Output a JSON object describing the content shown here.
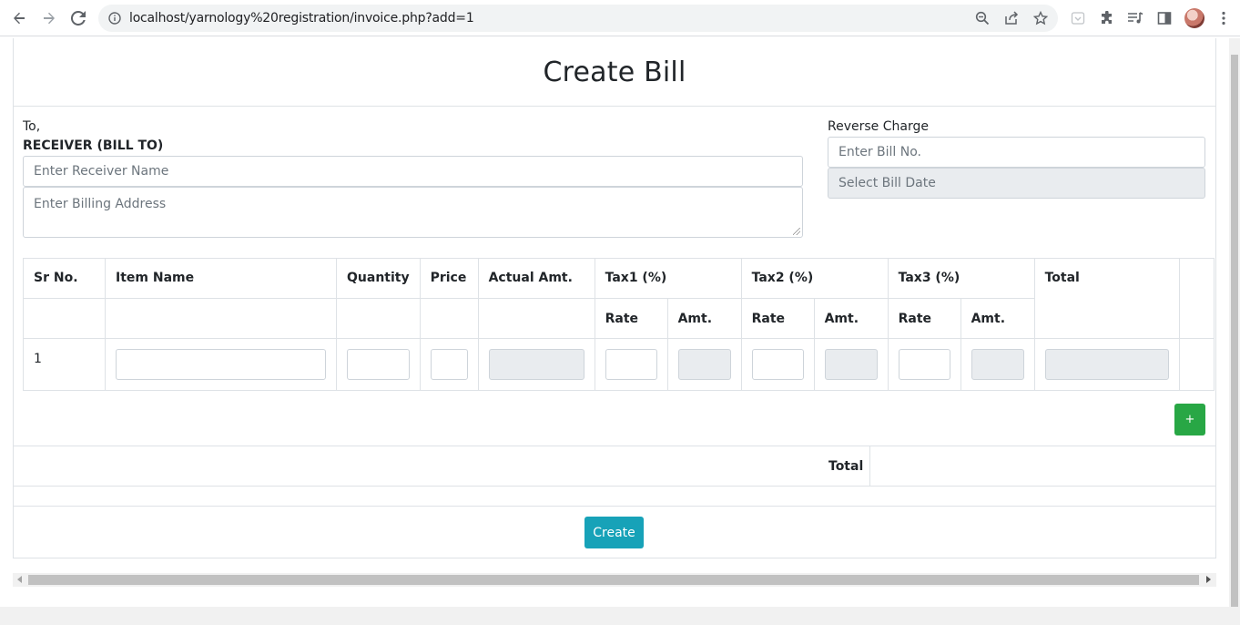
{
  "browser": {
    "url": "localhost/yarnology%20registration/invoice.php?add=1",
    "icons": [
      "back-arrow-icon",
      "forward-arrow-icon",
      "reload-icon",
      "info-icon",
      "zoom-icon",
      "share-icon",
      "star-icon",
      "pocket-icon",
      "extensions-icon",
      "media-icon",
      "sidebar-icon",
      "avatar",
      "menu-icon"
    ]
  },
  "page": {
    "title": "Create Bill"
  },
  "receiver": {
    "to_label": "To,",
    "heading": "RECEIVER (BILL TO)",
    "name_placeholder": "Enter Receiver Name",
    "address_placeholder": "Enter Billing Address"
  },
  "bill": {
    "reverse_charge_label": "Reverse Charge",
    "bill_no_placeholder": "Enter Bill No.",
    "bill_date_placeholder": "Select Bill Date"
  },
  "table": {
    "headers": {
      "sr_no": "Sr No.",
      "item_name": "Item Name",
      "quantity": "Quantity",
      "price": "Price",
      "actual_amt": "Actual Amt.",
      "tax1": "Tax1 (%)",
      "tax2": "Tax2 (%)",
      "tax3": "Tax3 (%)",
      "total": "Total"
    },
    "sub_headers": {
      "rate": "Rate",
      "amt": "Amt."
    },
    "rows": [
      {
        "sr_no": "1"
      }
    ]
  },
  "actions": {
    "add_row_label": "+",
    "total_label": "Total",
    "create_label": "Create"
  },
  "colors": {
    "add_button": "#28a745",
    "create_button": "#17a2b8"
  }
}
